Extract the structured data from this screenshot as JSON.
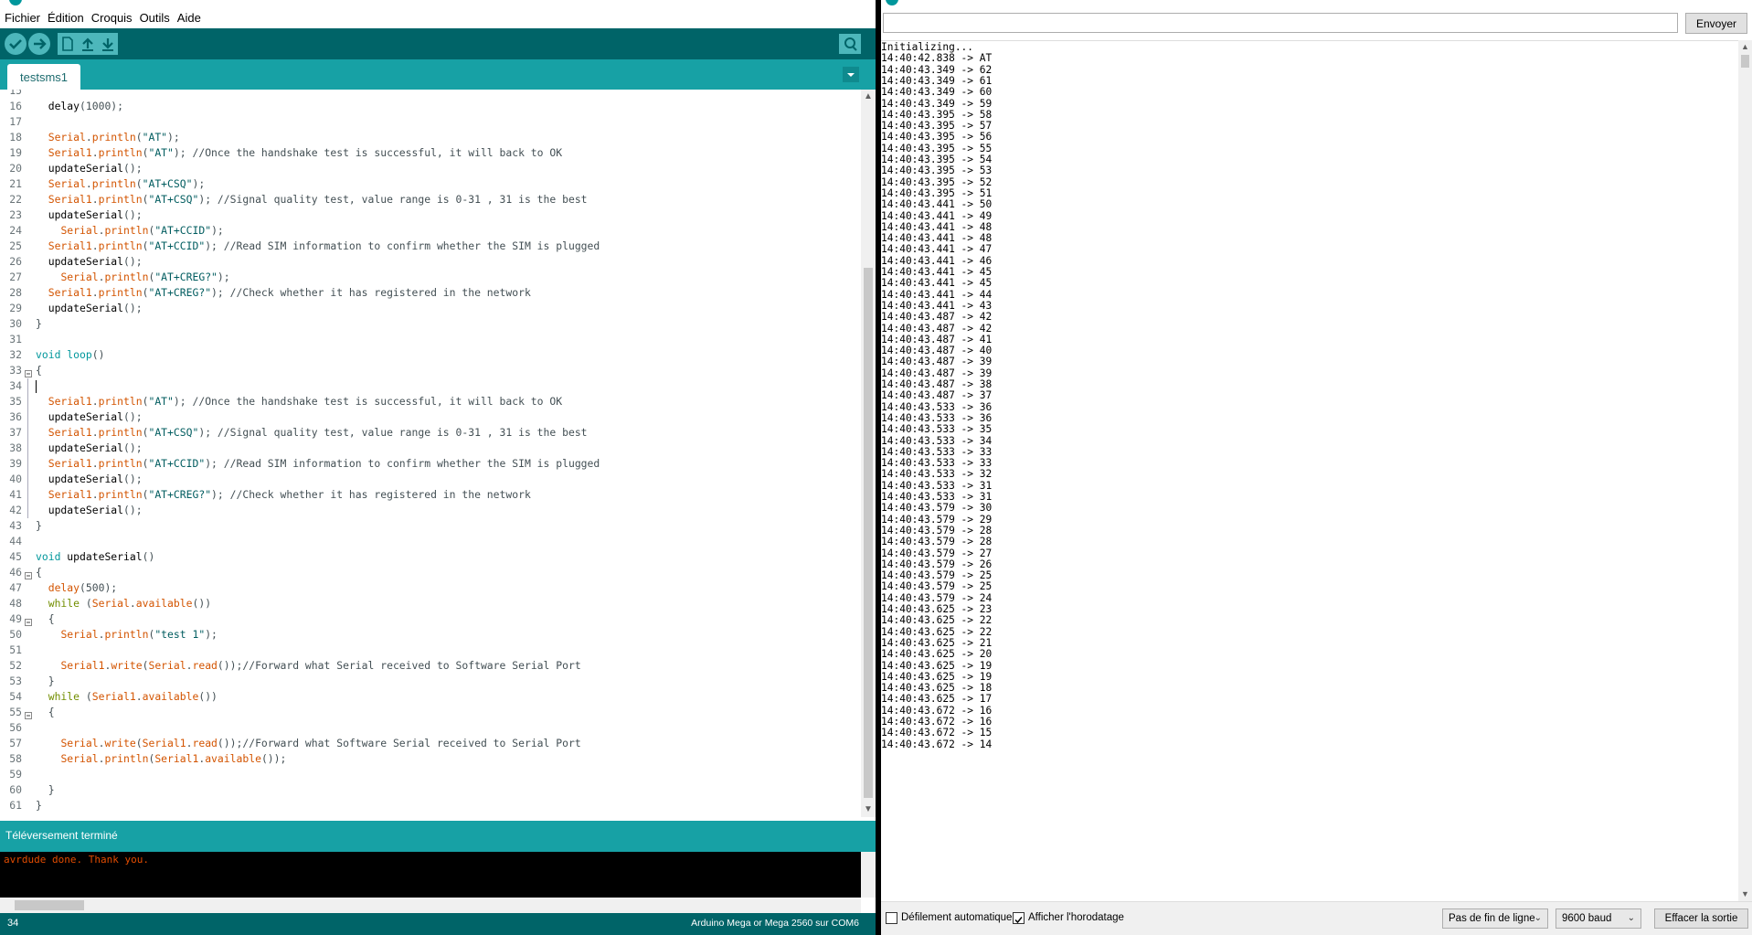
{
  "menu": [
    "Fichier",
    "Édition",
    "Croquis",
    "Outils",
    "Aide"
  ],
  "sketch_tab": "testsms1",
  "code_lines": [
    {
      "n": "15",
      "fold": false,
      "bracket": false,
      "segs": []
    },
    {
      "n": "16",
      "segs": [
        [
          "",
          "  "
        ],
        [
          "k-name",
          "delay"
        ],
        [
          "",
          "(1000);"
        ]
      ]
    },
    {
      "n": "17",
      "segs": []
    },
    {
      "n": "18",
      "segs": [
        [
          "",
          "  "
        ],
        [
          "k-obj",
          "Serial"
        ],
        [
          "",
          "."
        ],
        [
          "k-fn",
          "println"
        ],
        [
          "",
          "("
        ],
        [
          "k-str",
          "\"AT\""
        ],
        [
          "",
          ");"
        ]
      ]
    },
    {
      "n": "19",
      "segs": [
        [
          "",
          "  "
        ],
        [
          "k-obj",
          "Serial1"
        ],
        [
          "",
          "."
        ],
        [
          "k-fn",
          "println"
        ],
        [
          "",
          "("
        ],
        [
          "k-str",
          "\"AT\""
        ],
        [
          "",
          "); "
        ],
        [
          "k-cmt",
          "//Once the handshake test is successful, it will back to OK"
        ]
      ]
    },
    {
      "n": "20",
      "segs": [
        [
          "",
          "  "
        ],
        [
          "k-name",
          "updateSerial"
        ],
        [
          "",
          "();"
        ]
      ]
    },
    {
      "n": "21",
      "segs": [
        [
          "",
          "  "
        ],
        [
          "k-obj",
          "Serial"
        ],
        [
          "",
          "."
        ],
        [
          "k-fn",
          "println"
        ],
        [
          "",
          "("
        ],
        [
          "k-str",
          "\"AT+CSQ\""
        ],
        [
          "",
          ");"
        ]
      ]
    },
    {
      "n": "22",
      "segs": [
        [
          "",
          "  "
        ],
        [
          "k-obj",
          "Serial1"
        ],
        [
          "",
          "."
        ],
        [
          "k-fn",
          "println"
        ],
        [
          "",
          "("
        ],
        [
          "k-str",
          "\"AT+CSQ\""
        ],
        [
          "",
          "); "
        ],
        [
          "k-cmt",
          "//Signal quality test, value range is 0-31 , 31 is the best"
        ]
      ]
    },
    {
      "n": "23",
      "segs": [
        [
          "",
          "  "
        ],
        [
          "k-name",
          "updateSerial"
        ],
        [
          "",
          "();"
        ]
      ]
    },
    {
      "n": "24",
      "segs": [
        [
          "",
          "    "
        ],
        [
          "k-obj",
          "Serial"
        ],
        [
          "",
          "."
        ],
        [
          "k-fn",
          "println"
        ],
        [
          "",
          "("
        ],
        [
          "k-str",
          "\"AT+CCID\""
        ],
        [
          "",
          ");"
        ]
      ]
    },
    {
      "n": "25",
      "segs": [
        [
          "",
          "  "
        ],
        [
          "k-obj",
          "Serial1"
        ],
        [
          "",
          "."
        ],
        [
          "k-fn",
          "println"
        ],
        [
          "",
          "("
        ],
        [
          "k-str",
          "\"AT+CCID\""
        ],
        [
          "",
          "); "
        ],
        [
          "k-cmt",
          "//Read SIM information to confirm whether the SIM is plugged"
        ]
      ]
    },
    {
      "n": "26",
      "segs": [
        [
          "",
          "  "
        ],
        [
          "k-name",
          "updateSerial"
        ],
        [
          "",
          "();"
        ]
      ]
    },
    {
      "n": "27",
      "segs": [
        [
          "",
          "    "
        ],
        [
          "k-obj",
          "Serial"
        ],
        [
          "",
          "."
        ],
        [
          "k-fn",
          "println"
        ],
        [
          "",
          "("
        ],
        [
          "k-str",
          "\"AT+CREG?\""
        ],
        [
          "",
          ");"
        ]
      ]
    },
    {
      "n": "28",
      "segs": [
        [
          "",
          "  "
        ],
        [
          "k-obj",
          "Serial1"
        ],
        [
          "",
          "."
        ],
        [
          "k-fn",
          "println"
        ],
        [
          "",
          "("
        ],
        [
          "k-str",
          "\"AT+CREG?\""
        ],
        [
          "",
          "); "
        ],
        [
          "k-cmt",
          "//Check whether it has registered in the network"
        ]
      ]
    },
    {
      "n": "29",
      "segs": [
        [
          "",
          "  "
        ],
        [
          "k-name",
          "updateSerial"
        ],
        [
          "",
          "();"
        ]
      ]
    },
    {
      "n": "30",
      "segs": [
        [
          "",
          "}"
        ]
      ]
    },
    {
      "n": "31",
      "segs": []
    },
    {
      "n": "32",
      "segs": [
        [
          "k-type",
          "void"
        ],
        [
          "",
          " "
        ],
        [
          "k-type",
          "loop"
        ],
        [
          "",
          "()"
        ]
      ]
    },
    {
      "n": "33",
      "fold": true,
      "segs": [
        [
          "",
          "{"
        ]
      ]
    },
    {
      "n": "34",
      "bracket": true,
      "cursor": true,
      "segs": []
    },
    {
      "n": "35",
      "bracket": true,
      "segs": [
        [
          "",
          "  "
        ],
        [
          "k-obj",
          "Serial1"
        ],
        [
          "",
          "."
        ],
        [
          "k-fn",
          "println"
        ],
        [
          "",
          "("
        ],
        [
          "k-str",
          "\"AT\""
        ],
        [
          "",
          "); "
        ],
        [
          "k-cmt",
          "//Once the handshake test is successful, it will back to OK"
        ]
      ]
    },
    {
      "n": "36",
      "bracket": true,
      "segs": [
        [
          "",
          "  "
        ],
        [
          "k-name",
          "updateSerial"
        ],
        [
          "",
          "();"
        ]
      ]
    },
    {
      "n": "37",
      "bracket": true,
      "segs": [
        [
          "",
          "  "
        ],
        [
          "k-obj",
          "Serial1"
        ],
        [
          "",
          "."
        ],
        [
          "k-fn",
          "println"
        ],
        [
          "",
          "("
        ],
        [
          "k-str",
          "\"AT+CSQ\""
        ],
        [
          "",
          "); "
        ],
        [
          "k-cmt",
          "//Signal quality test, value range is 0-31 , 31 is the best"
        ]
      ]
    },
    {
      "n": "38",
      "bracket": true,
      "segs": [
        [
          "",
          "  "
        ],
        [
          "k-name",
          "updateSerial"
        ],
        [
          "",
          "();"
        ]
      ]
    },
    {
      "n": "39",
      "bracket": true,
      "segs": [
        [
          "",
          "  "
        ],
        [
          "k-obj",
          "Serial1"
        ],
        [
          "",
          "."
        ],
        [
          "k-fn",
          "println"
        ],
        [
          "",
          "("
        ],
        [
          "k-str",
          "\"AT+CCID\""
        ],
        [
          "",
          "); "
        ],
        [
          "k-cmt",
          "//Read SIM information to confirm whether the SIM is plugged"
        ]
      ]
    },
    {
      "n": "40",
      "bracket": true,
      "segs": [
        [
          "",
          "  "
        ],
        [
          "k-name",
          "updateSerial"
        ],
        [
          "",
          "();"
        ]
      ]
    },
    {
      "n": "41",
      "bracket": true,
      "segs": [
        [
          "",
          "  "
        ],
        [
          "k-obj",
          "Serial1"
        ],
        [
          "",
          "."
        ],
        [
          "k-fn",
          "println"
        ],
        [
          "",
          "("
        ],
        [
          "k-str",
          "\"AT+CREG?\""
        ],
        [
          "",
          "); "
        ],
        [
          "k-cmt",
          "//Check whether it has registered in the network"
        ]
      ]
    },
    {
      "n": "42",
      "bracket": true,
      "segs": [
        [
          "",
          "  "
        ],
        [
          "k-name",
          "updateSerial"
        ],
        [
          "",
          "();"
        ]
      ]
    },
    {
      "n": "43",
      "segs": [
        [
          "",
          "}"
        ]
      ]
    },
    {
      "n": "44",
      "segs": []
    },
    {
      "n": "45",
      "segs": [
        [
          "k-type",
          "void"
        ],
        [
          "",
          " "
        ],
        [
          "k-name",
          "updateSerial"
        ],
        [
          "",
          "()"
        ]
      ]
    },
    {
      "n": "46",
      "fold": true,
      "segs": [
        [
          "",
          "{"
        ]
      ]
    },
    {
      "n": "47",
      "segs": [
        [
          "",
          "  "
        ],
        [
          "k-fn",
          "delay"
        ],
        [
          "",
          "(500);"
        ]
      ]
    },
    {
      "n": "48",
      "segs": [
        [
          "",
          "  "
        ],
        [
          "k-ctl",
          "while"
        ],
        [
          "",
          " ("
        ],
        [
          "k-obj",
          "Serial"
        ],
        [
          "",
          "."
        ],
        [
          "k-fn",
          "available"
        ],
        [
          "",
          "())"
        ]
      ]
    },
    {
      "n": "49",
      "fold": true,
      "segs": [
        [
          "",
          "  {"
        ]
      ]
    },
    {
      "n": "50",
      "segs": [
        [
          "",
          "    "
        ],
        [
          "k-obj",
          "Serial"
        ],
        [
          "",
          "."
        ],
        [
          "k-fn",
          "println"
        ],
        [
          "",
          "("
        ],
        [
          "k-str",
          "\"test 1\""
        ],
        [
          "",
          ");"
        ]
      ]
    },
    {
      "n": "51",
      "segs": []
    },
    {
      "n": "52",
      "segs": [
        [
          "",
          "    "
        ],
        [
          "k-obj",
          "Serial1"
        ],
        [
          "",
          "."
        ],
        [
          "k-fn",
          "write"
        ],
        [
          "",
          "("
        ],
        [
          "k-obj",
          "Serial"
        ],
        [
          "",
          "."
        ],
        [
          "k-fn",
          "read"
        ],
        [
          "",
          "());"
        ],
        [
          "k-cmt",
          "//Forward what Serial received to Software Serial Port"
        ]
      ]
    },
    {
      "n": "53",
      "segs": [
        [
          "",
          "  }"
        ]
      ]
    },
    {
      "n": "54",
      "segs": [
        [
          "",
          "  "
        ],
        [
          "k-ctl",
          "while"
        ],
        [
          "",
          " ("
        ],
        [
          "k-obj",
          "Serial1"
        ],
        [
          "",
          "."
        ],
        [
          "k-fn",
          "available"
        ],
        [
          "",
          "())"
        ]
      ]
    },
    {
      "n": "55",
      "fold": true,
      "segs": [
        [
          "",
          "  {"
        ]
      ]
    },
    {
      "n": "56",
      "segs": []
    },
    {
      "n": "57",
      "segs": [
        [
          "",
          "    "
        ],
        [
          "k-obj",
          "Serial"
        ],
        [
          "",
          "."
        ],
        [
          "k-fn",
          "write"
        ],
        [
          "",
          "("
        ],
        [
          "k-obj",
          "Serial1"
        ],
        [
          "",
          "."
        ],
        [
          "k-fn",
          "read"
        ],
        [
          "",
          "());"
        ],
        [
          "k-cmt",
          "//Forward what Software Serial received to Serial Port"
        ]
      ]
    },
    {
      "n": "58",
      "segs": [
        [
          "",
          "    "
        ],
        [
          "k-obj",
          "Serial"
        ],
        [
          "",
          "."
        ],
        [
          "k-fn",
          "println"
        ],
        [
          "",
          "("
        ],
        [
          "k-obj",
          "Serial1"
        ],
        [
          "",
          "."
        ],
        [
          "k-fn",
          "available"
        ],
        [
          "",
          "());"
        ]
      ]
    },
    {
      "n": "59",
      "segs": []
    },
    {
      "n": "60",
      "segs": [
        [
          "",
          "  }"
        ]
      ]
    },
    {
      "n": "61",
      "segs": [
        [
          "",
          "}"
        ]
      ]
    }
  ],
  "status_message": "Téléversement terminé",
  "console_output": "avrdude done.  Thank you.",
  "footer": {
    "line": "34",
    "board": "Arduino Mega or Mega 2560 sur COM6"
  },
  "monitor": {
    "send_placeholder": "",
    "send_label": "Envoyer",
    "lines": [
      "Initializing...",
      "14:40:42.838 -> AT",
      "14:40:43.349 -> 62",
      "14:40:43.349 -> 61",
      "14:40:43.349 -> 60",
      "14:40:43.349 -> 59",
      "14:40:43.395 -> 58",
      "14:40:43.395 -> 57",
      "14:40:43.395 -> 56",
      "14:40:43.395 -> 55",
      "14:40:43.395 -> 54",
      "14:40:43.395 -> 53",
      "14:40:43.395 -> 52",
      "14:40:43.395 -> 51",
      "14:40:43.441 -> 50",
      "14:40:43.441 -> 49",
      "14:40:43.441 -> 48",
      "14:40:43.441 -> 48",
      "14:40:43.441 -> 47",
      "14:40:43.441 -> 46",
      "14:40:43.441 -> 45",
      "14:40:43.441 -> 45",
      "14:40:43.441 -> 44",
      "14:40:43.441 -> 43",
      "14:40:43.487 -> 42",
      "14:40:43.487 -> 42",
      "14:40:43.487 -> 41",
      "14:40:43.487 -> 40",
      "14:40:43.487 -> 39",
      "14:40:43.487 -> 39",
      "14:40:43.487 -> 38",
      "14:40:43.487 -> 37",
      "14:40:43.533 -> 36",
      "14:40:43.533 -> 36",
      "14:40:43.533 -> 35",
      "14:40:43.533 -> 34",
      "14:40:43.533 -> 33",
      "14:40:43.533 -> 33",
      "14:40:43.533 -> 32",
      "14:40:43.533 -> 31",
      "14:40:43.533 -> 31",
      "14:40:43.579 -> 30",
      "14:40:43.579 -> 29",
      "14:40:43.579 -> 28",
      "14:40:43.579 -> 28",
      "14:40:43.579 -> 27",
      "14:40:43.579 -> 26",
      "14:40:43.579 -> 25",
      "14:40:43.579 -> 25",
      "14:40:43.579 -> 24",
      "14:40:43.625 -> 23",
      "14:40:43.625 -> 22",
      "14:40:43.625 -> 22",
      "14:40:43.625 -> 21",
      "14:40:43.625 -> 20",
      "14:40:43.625 -> 19",
      "14:40:43.625 -> 19",
      "14:40:43.625 -> 18",
      "14:40:43.625 -> 17",
      "14:40:43.672 -> 16",
      "14:40:43.672 -> 16",
      "14:40:43.672 -> 15",
      "14:40:43.672 -> 14"
    ],
    "autoscroll_label": "Défilement automatique",
    "autoscroll_checked": false,
    "timestamp_label": "Afficher l'horodatage",
    "timestamp_checked": true,
    "line_ending": "Pas de fin de ligne",
    "baud": "9600 baud",
    "clear_label": "Effacer la sortie"
  },
  "colors": {
    "teal_dark": "#006468",
    "teal": "#17a1a5",
    "console_text": "#e34c00"
  }
}
